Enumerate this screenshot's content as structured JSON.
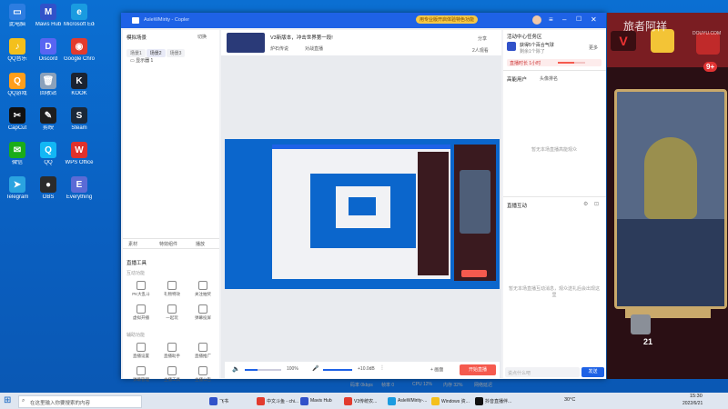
{
  "desktop": {
    "icons": [
      {
        "label": "此电脑",
        "color": "#2d7de0",
        "glyph": "▭"
      },
      {
        "label": "Mavis Hub",
        "color": "#3152c9",
        "glyph": "M"
      },
      {
        "label": "Microsoft Edge",
        "color": "#1a9be0",
        "glyph": "e"
      },
      {
        "label": "QQ音乐",
        "color": "#f4c01c",
        "glyph": "♪"
      },
      {
        "label": "Discord",
        "color": "#5865f2",
        "glyph": "D"
      },
      {
        "label": "Google Chrome",
        "color": "#e23b2e",
        "glyph": "◉"
      },
      {
        "label": "QQ游戏",
        "color": "#ff9e1b",
        "glyph": "Q"
      },
      {
        "label": "回收站",
        "color": "#8aa1bb",
        "glyph": "🗑"
      },
      {
        "label": "KOOK",
        "color": "#1b2331",
        "glyph": "K"
      },
      {
        "label": "CapCut",
        "color": "#111",
        "glyph": "✂"
      },
      {
        "label": "剪映",
        "color": "#1e1e1e",
        "glyph": "✎"
      },
      {
        "label": "Steam",
        "color": "#1b2838",
        "glyph": "S"
      },
      {
        "label": "微信",
        "color": "#1aad19",
        "glyph": "✉"
      },
      {
        "label": "QQ",
        "color": "#12b7f5",
        "glyph": "Q"
      },
      {
        "label": "WPS Office",
        "color": "#e0312b",
        "glyph": "W"
      },
      {
        "label": "Telegram",
        "color": "#2aa3e0",
        "glyph": "➤"
      },
      {
        "label": "OBS",
        "color": "#2b2b2b",
        "glyph": "●"
      },
      {
        "label": "Everything",
        "color": "#5b6bd6",
        "glyph": "E"
      }
    ]
  },
  "app": {
    "title": "AsleWMirity - Copler",
    "notice": "用专业版开启体验特色功能",
    "left": {
      "header": "模拟场景",
      "switch_label": "切换",
      "tabs": [
        "场景1",
        "场景2",
        "场景3"
      ],
      "scene_item": "显示器 1",
      "bottom_actions": [
        "素材",
        "特效组件",
        "播放"
      ],
      "tools_title": "直播工具",
      "group1": "互动功能",
      "tools1": [
        "PK大乱斗",
        "礼物特效",
        "关注抽奖",
        "虚拟开播",
        "一起玩",
        "弹幕投屏"
      ],
      "group2": "辅助功能",
      "tools2": [
        "直播设置",
        "直播助手",
        "直播推广",
        "弹幕管理",
        "主播工具",
        "主播公告"
      ]
    },
    "center": {
      "stream_title": "V3新版本，冲击世界第一段!",
      "category": "炉石传说",
      "room_label": "对战直播",
      "share_label": "分享",
      "zoom_label": "2人观看",
      "volume_pct": "100%",
      "mic_db": "+10.0dB",
      "start_button": "开始直播",
      "scene_button": "+ 画面",
      "stats": [
        "码率 0kbps",
        "帧率 0",
        "CPU 12%",
        "内存 32%",
        "网络延迟"
      ]
    },
    "right": {
      "activity_title": "活动中心任务区",
      "activity_text": "获得5个百合气球",
      "activity_sub": "剩余1个除了",
      "more_label": "更多",
      "progress_label": "直播时长 1小时",
      "progress_value": 0.6,
      "online_title": "高能用户",
      "online_tab": "头像排名",
      "placeholder_online": "暂无本场直播高能观众",
      "interact_title": "直播互动",
      "placeholder_interact": "暂无本场直播互动消息，观众送礼后会出现这里",
      "chat_placeholder": "说点什么吧",
      "send_label": "发送"
    }
  },
  "game": {
    "watermark": "旅者阿祥",
    "badge": "9+",
    "coins": "21",
    "coins2": "21",
    "logo_sub": "DOUYU.COM"
  },
  "taskbar": {
    "search_placeholder": "在这里输入你要搜索的内容",
    "items": [
      "飞书",
      "中文斗鱼 - chi...",
      "Mavis Hub",
      "V3传统农...",
      "AsleWMirity-...",
      "Windows 资...",
      "抖音直播伴..."
    ],
    "temperature": "30°C",
    "time": "15:30",
    "date": "2022/6/21"
  },
  "colors": {
    "accent": "#1e62e6",
    "start": "#f55a4e",
    "desktop": "#0b6fd2"
  }
}
